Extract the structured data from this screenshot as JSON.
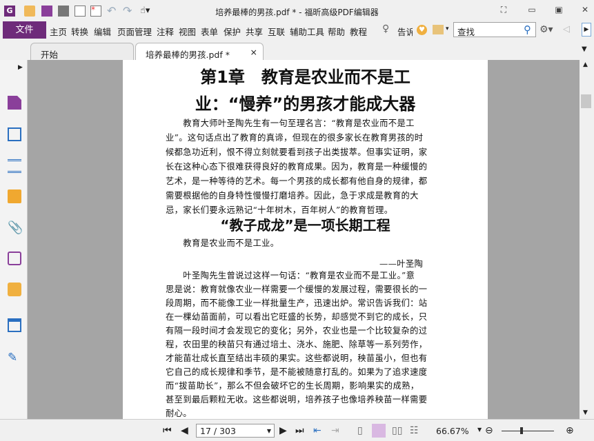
{
  "window": {
    "title": "培养最棒的男孩.pdf * - 福昕高级PDF编辑器"
  },
  "menu": {
    "file": "文件",
    "items": [
      "主页",
      "转换",
      "编辑",
      "页面管理",
      "注释",
      "视图",
      "表单",
      "保护",
      "共享",
      "互联",
      "辅助工具",
      "帮助",
      "教程"
    ],
    "tell": "告诉",
    "search_placeholder": "查找"
  },
  "tabs": [
    {
      "label": "开始"
    },
    {
      "label": "培养最棒的男孩.pdf *",
      "close": "×"
    }
  ],
  "document": {
    "title_line1": "第1章　教育是农业而不是工",
    "title_line2": "业：“慢养”的男孩才能成大器",
    "para1": [
      "　　教育大师叶圣陶先生有一句至理名言：“教育是农业而不是工",
      "业”。这句话点出了教育的真谛，但现在的很多家长在教育男孩的时",
      "候都急功近利，恨不得立刻就要看到孩子出类拔萃。但事实证明，家",
      "长在这种心态下很难获得良好的教育成果。因为，教育是一种缓慢的",
      "艺术，是一种等待的艺术。每一个男孩的成长都有他自身的规律，都",
      "需要根据他的自身特性慢慢打磨培养。因此，急于求成是教育的大",
      "忌，家长们要永远熟记“十年树木，百年树人”的教育哲理。"
    ],
    "heading2": "“教子成龙”是一项长期工程",
    "quote": "　　教育是农业而不是工业。",
    "attribution": "——叶圣陶",
    "para2": [
      "　　叶圣陶先生曾说过这样一句话：“教育是农业而不是工业。”意",
      "思是说：教育就像农业一样需要一个缓慢的发展过程，需要很长的一",
      "段周期，而不能像工业一样批量生产，迅速出炉。常识告诉我们：站",
      "在一棵幼苗面前，可以看出它旺盛的长势，却感觉不到它的成长，只",
      "有隔一段时间才会发现它的变化；另外，农业也是一个比较复杂的过",
      "程，农田里的秧苗只有通过培土、浇水、施肥、除草等一系列劳作，",
      "才能苗壮成长直至结出丰硕的果实。这些都说明，秧苗虽小，但也有",
      "它自己的成长规律和季节，是不能被随意打乱的。如果为了追求速度",
      "而“拔苗助长”，那么不但会破坏它的生长周期，影响果实的成熟，",
      "甚至到最后颗粒无收。这些都说明，培养孩子也像培养秧苗一样需要",
      "耐心。"
    ]
  },
  "status": {
    "page": "17 / 303",
    "zoom": "66.67%",
    "zoom_fraction": 0.33
  },
  "colors": {
    "accent": "#6e2b7a",
    "canvas": "#a5a5a5"
  }
}
